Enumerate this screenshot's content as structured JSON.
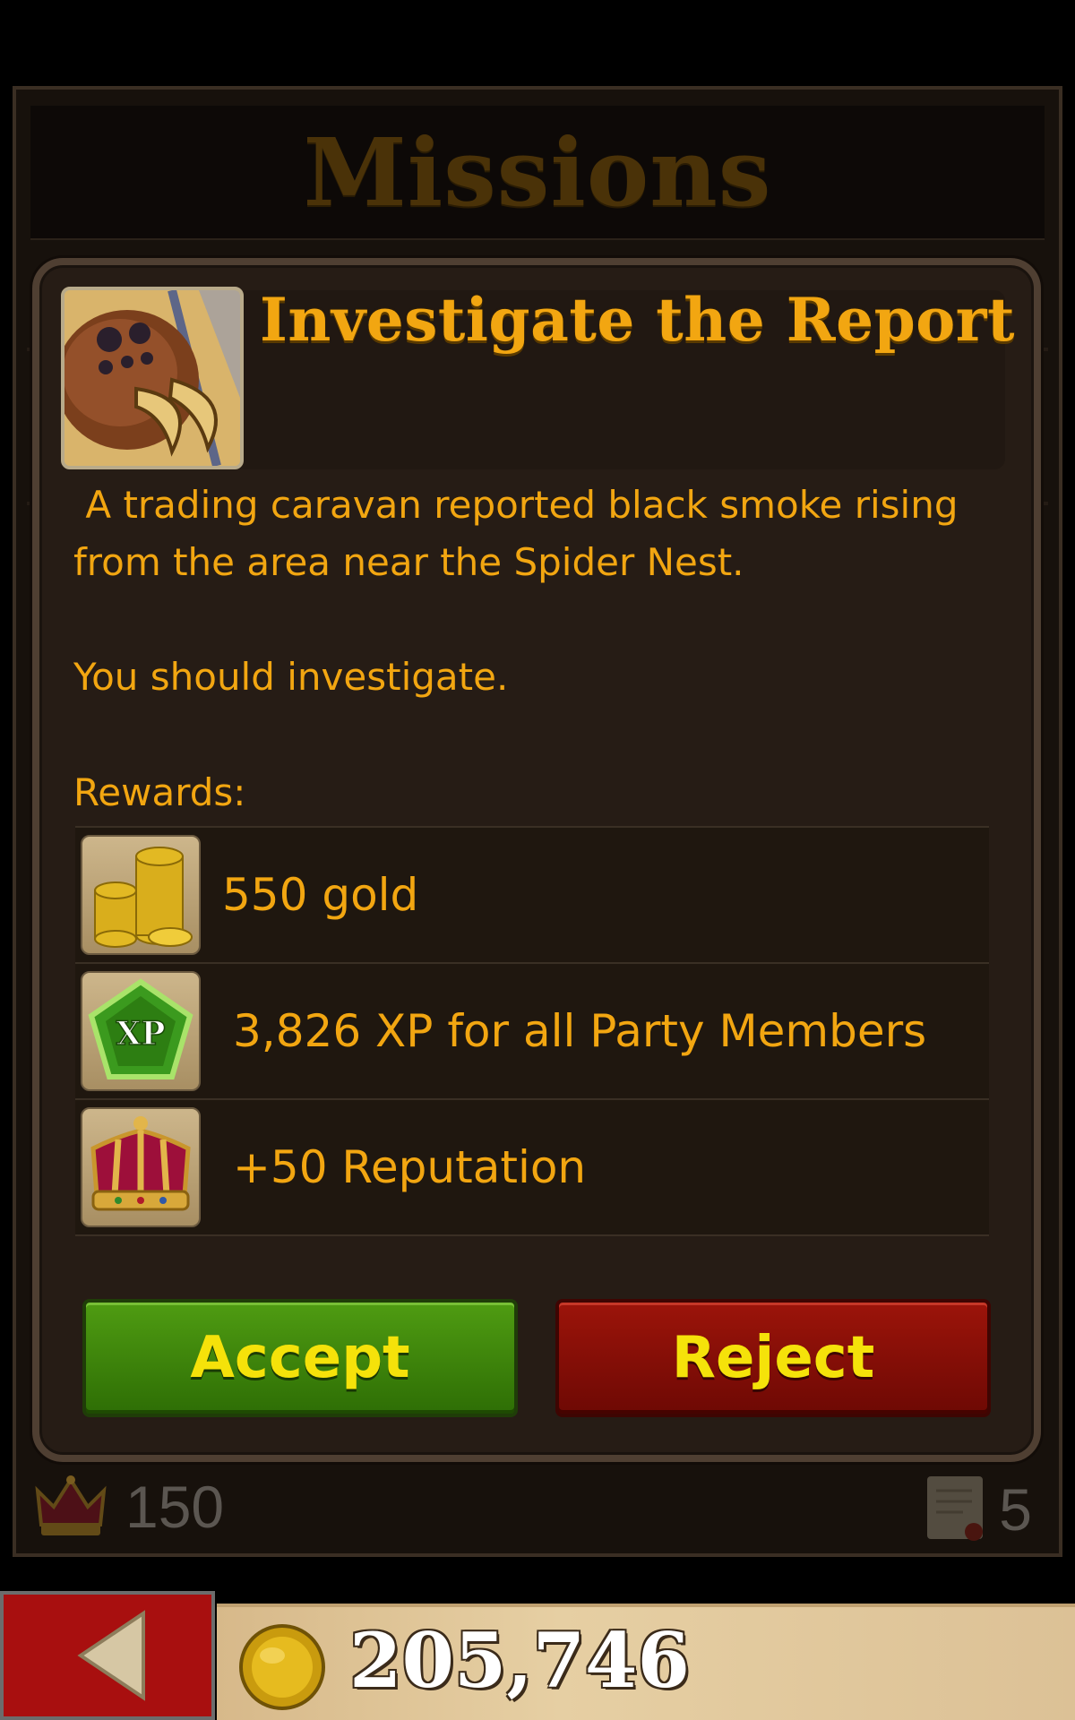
{
  "header": {
    "title": "Missions"
  },
  "mission": {
    "title": "Investigate the Report",
    "portrait_icon": "spider-portrait-icon",
    "description": [
      " A trading caravan reported black smoke rising from the area near the Spider Nest.",
      "You should investigate."
    ],
    "rewards_label": "Rewards:",
    "rewards": [
      {
        "icon": "gold-coins-icon",
        "text": "550 gold"
      },
      {
        "icon": "xp-badge-icon",
        "text": "3,826 XP for all Party Members"
      },
      {
        "icon": "crown-icon",
        "text": "+50 Reputation"
      }
    ],
    "actions": {
      "accept_label": "Accept",
      "reject_label": "Reject"
    }
  },
  "stats": {
    "reputation": "150",
    "scrolls": "5"
  },
  "footer": {
    "gold_total": "205,746"
  },
  "colors": {
    "text_gold": "#f2a611",
    "accept_green": "#3d8a0c",
    "reject_red": "#8a0e06",
    "button_text": "#f5e20a",
    "back_red": "#a80f0f"
  }
}
